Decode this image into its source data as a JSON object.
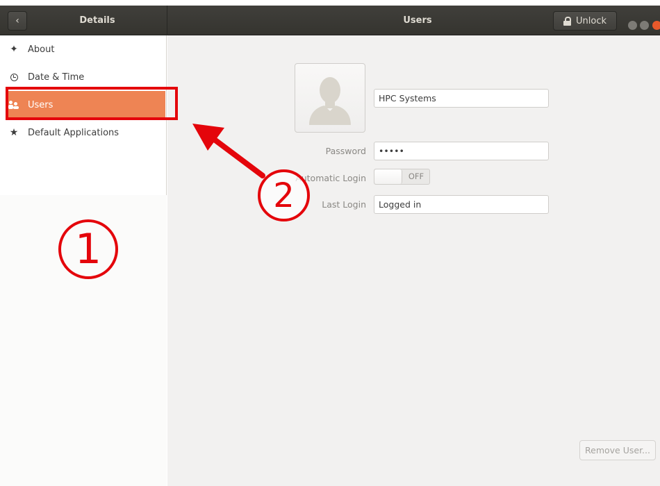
{
  "header": {
    "back_glyph": "‹",
    "sidebar_title": "Details",
    "title": "Users",
    "unlock_label": "Unlock"
  },
  "sidebar": {
    "items": [
      {
        "label": "About",
        "icon": "star-four-point-icon"
      },
      {
        "label": "Date & Time",
        "icon": "clock-icon"
      },
      {
        "label": "Users",
        "icon": "users-icon",
        "active": true
      },
      {
        "label": "Default Applications",
        "icon": "star-icon"
      }
    ]
  },
  "user": {
    "name": "HPC Systems",
    "password_label": "Password",
    "password_value": "•••••",
    "autologin_label": "Automatic Login",
    "autologin_state": "OFF",
    "lastlogin_label": "Last Login",
    "lastlogin_value": "Logged in"
  },
  "actions": {
    "remove_user": "Remove User..."
  },
  "annotations": {
    "step1": "1",
    "step2": "2",
    "color": "#e4050b"
  },
  "colors": {
    "accent": "#ee8454",
    "headerbar": "#3b3a36"
  }
}
